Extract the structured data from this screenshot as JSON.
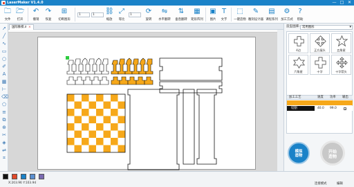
{
  "window": {
    "title": "LaserMaker V1.4.0",
    "min": "—",
    "max": "□",
    "close": "✕"
  },
  "toolbar": {
    "file": "文件",
    "open": "打开",
    "undo": "撤销",
    "redo": "恢复",
    "cut": "切断图形",
    "zoom": "缩放",
    "zoom_value": "1",
    "scale": "等比",
    "rotate": "旋转",
    "hflip": "水平翻转",
    "vflip": "垂直翻转",
    "array": "矩形阵列",
    "align": "图片",
    "text": "文字",
    "oneclick": "一键造物",
    "engrave_design": "雕刻设计器",
    "course": "课程系列",
    "process": "加工方式",
    "help": "帮助"
  },
  "tabs": [
    {
      "label": "国际象棋.lr",
      "close": "×"
    }
  ],
  "right_panel": {
    "shape_lib_label": "造型图库:",
    "shape_lib_value": "常用图形",
    "shapes": [
      {
        "label": "4边",
        "icon": "cross-blob"
      },
      {
        "label": "正方展头",
        "icon": "cross-arrow"
      },
      {
        "label": "五角星",
        "icon": "star5"
      },
      {
        "label": "六角星",
        "icon": "star6"
      },
      {
        "label": "十字",
        "icon": "plus"
      },
      {
        "label": "十字箭头",
        "icon": "cross-arrows"
      }
    ],
    "layer_table": {
      "headers": [
        "加工工艺",
        "速度",
        "功率",
        "输出"
      ],
      "rows": [
        {
          "process": "",
          "speed": "",
          "power": "",
          "output": "",
          "color": "#f6a81a"
        },
        {
          "process": "切割",
          "speed": "40.0",
          "power": "99.0",
          "output": "✓",
          "color": "#111111"
        }
      ]
    },
    "simulate_label": "模拟\n造物",
    "start_label": "开始\n造物"
  },
  "status": {
    "swatches": [
      "#111111",
      "#e24a2b",
      "#1a82c8",
      "#5a8fd0",
      "#7a6ab0"
    ],
    "coords": "X:203.96 Y:103.94",
    "left_tools": "连接模式",
    "right_tools": "编辑"
  },
  "colors": {
    "accent": "#1a82c8",
    "orange": "#f6a81a"
  }
}
